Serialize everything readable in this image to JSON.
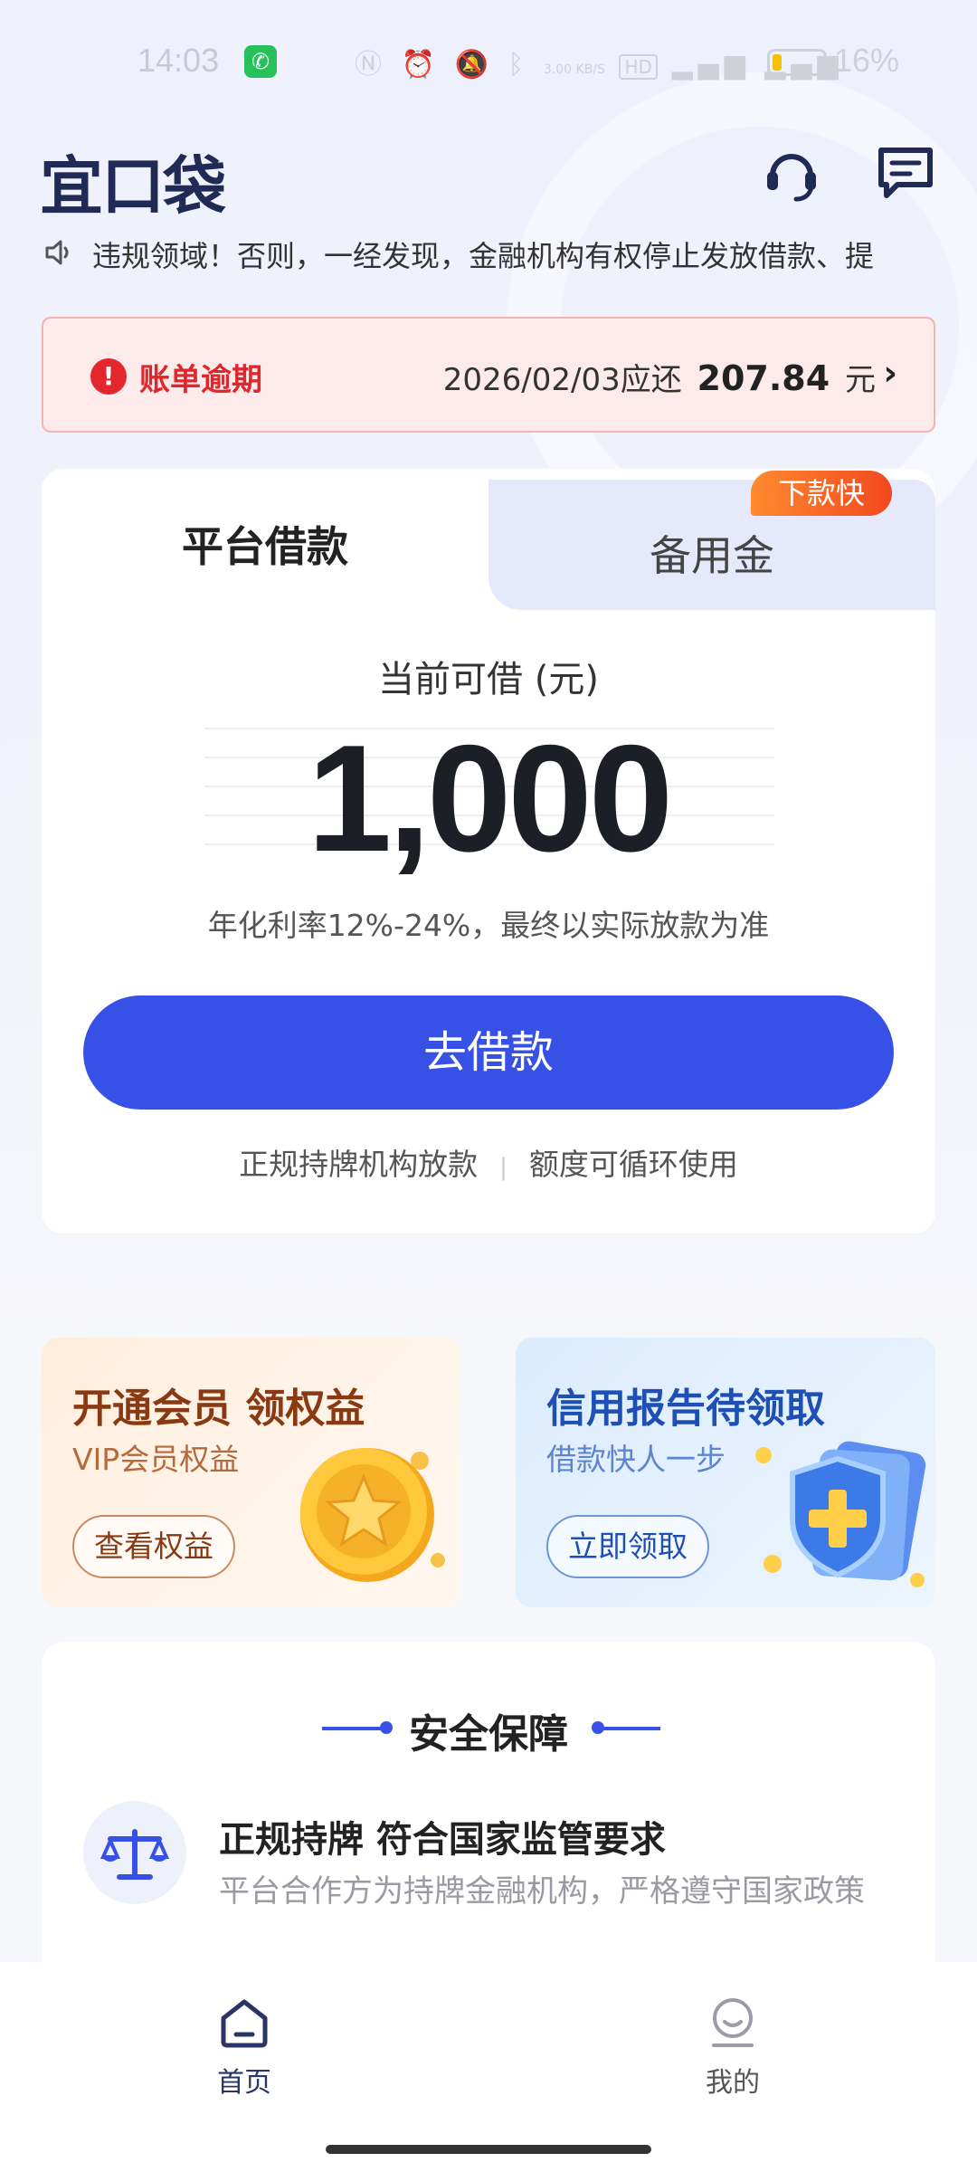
{
  "status_bar": {
    "time": "14:03",
    "net_speed": "3.00 KB/S",
    "battery": "16%",
    "icons": [
      "nfc-icon",
      "alarm-icon",
      "mute-icon",
      "bluetooth-icon",
      "hd-icon",
      "signal-icon",
      "signal-icon"
    ]
  },
  "header": {
    "logo": "宜口袋",
    "icons": [
      "headset-icon",
      "message-icon"
    ]
  },
  "notice": {
    "text": "违规领域！否则，一经发现，金融机构有权停止发放借款、提"
  },
  "overdue": {
    "title": "账单逾期",
    "due_text": "2026/02/03应还",
    "amount": "207.84",
    "unit": "元"
  },
  "loan": {
    "tab_primary": "平台借款",
    "tab_secondary": "备用金",
    "tab_badge": "下款快",
    "available_label": "当前可借 (元)",
    "amount": "1,000",
    "rate_note": "年化利率12%-24%，最终以实际放款为准",
    "button": "去借款",
    "feature1": "正规持牌机构放款",
    "feature2": "额度可循环使用"
  },
  "promos": {
    "vip": {
      "title": "开通会员 领权益",
      "subtitle": "VIP会员权益",
      "button": "查看权益"
    },
    "credit": {
      "title": "信用报告待领取",
      "subtitle": "借款快人一步",
      "button": "立即领取"
    }
  },
  "security": {
    "title": "安全保障",
    "item_title": "正规持牌 符合国家监管要求",
    "item_desc": "平台合作方为持牌金融机构，严格遵守国家政策"
  },
  "bottom_nav": {
    "home": "首页",
    "mine": "我的"
  },
  "colors": {
    "accent": "#3751e6",
    "danger": "#e0262b",
    "badge": "#f2481f"
  }
}
